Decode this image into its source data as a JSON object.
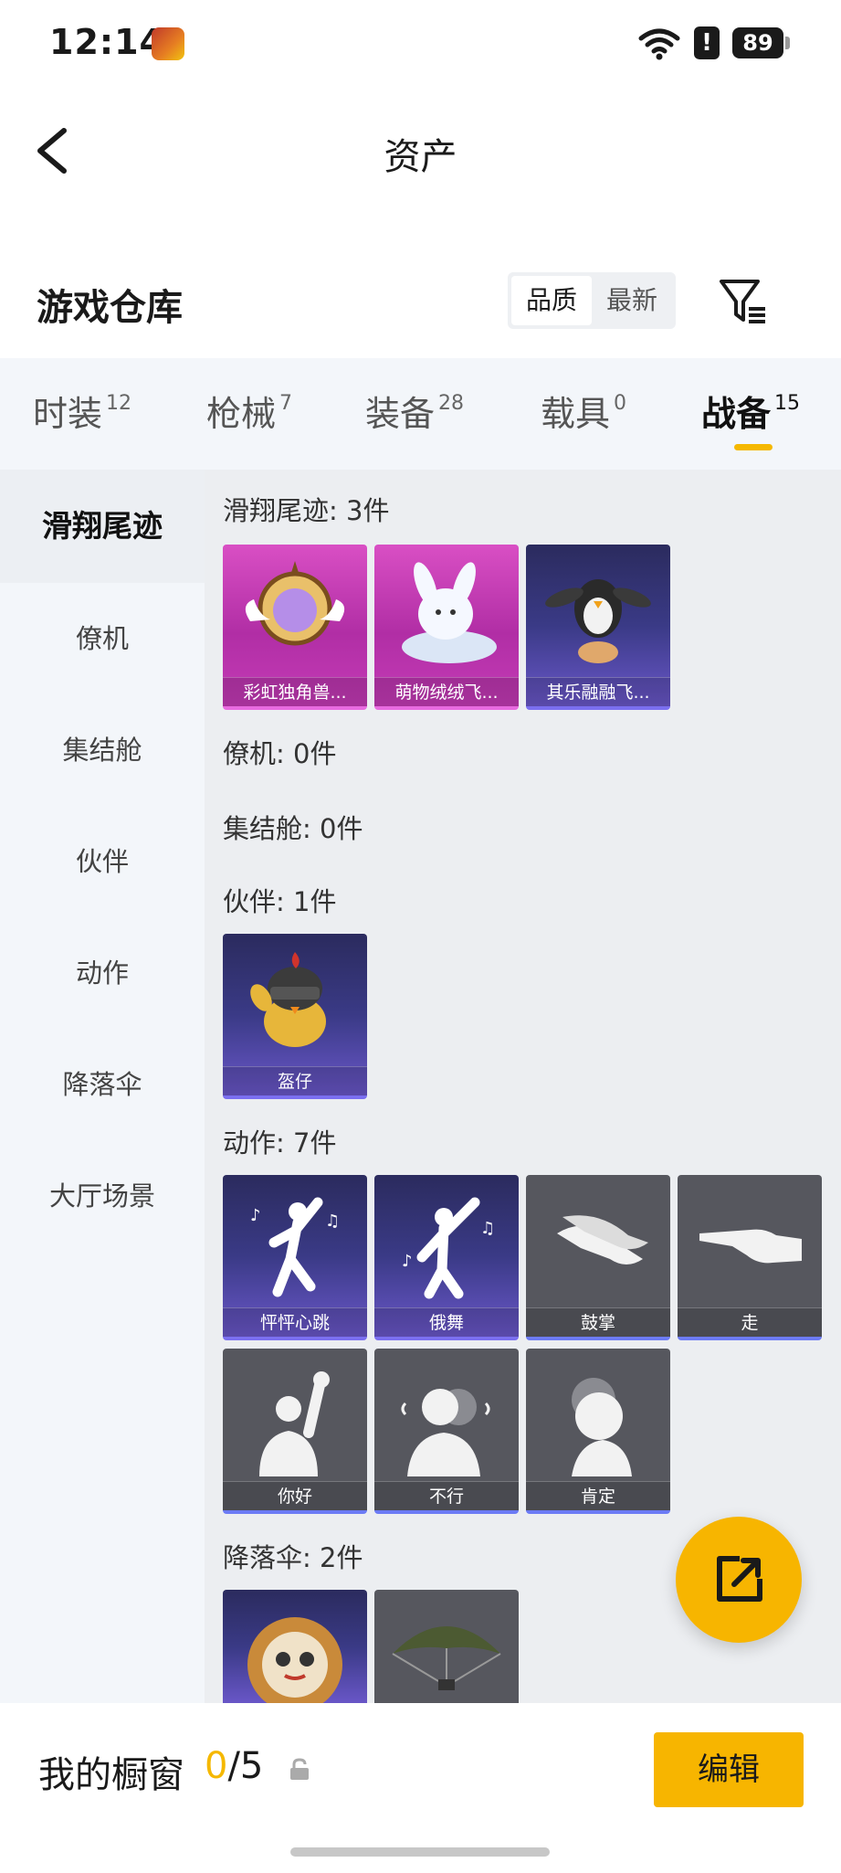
{
  "status_bar": {
    "time": "12:14",
    "alert": "!",
    "battery": "89"
  },
  "header": {
    "title": "资产"
  },
  "warehouse": {
    "title": "游戏仓库",
    "sort_options": [
      "品质",
      "最新"
    ],
    "sort_selected": "品质"
  },
  "tabs": [
    {
      "label": "时装",
      "count": "12"
    },
    {
      "label": "枪械",
      "count": "7"
    },
    {
      "label": "装备",
      "count": "28"
    },
    {
      "label": "载具",
      "count": "0"
    },
    {
      "label": "战备",
      "count": "15",
      "active": true
    }
  ],
  "sidebar": {
    "items": [
      "滑翔尾迹",
      "僚机",
      "集结舱",
      "伙伴",
      "动作",
      "降落伞",
      "大厅场景"
    ],
    "active": "滑翔尾迹"
  },
  "sections": {
    "glide": {
      "label": "滑翔尾迹: 3件",
      "items": [
        "彩虹独角兽...",
        "萌物绒绒飞...",
        "其乐融融飞..."
      ]
    },
    "wingman": {
      "label": "僚机: 0件"
    },
    "pod": {
      "label": "集结舱: 0件"
    },
    "companion": {
      "label": "伙伴: 1件",
      "items": [
        "盔仔"
      ]
    },
    "emote": {
      "label": "动作: 7件",
      "items": [
        "怦怦心跳",
        "俄舞",
        "鼓掌",
        "走",
        "你好",
        "不行",
        "肯定"
      ]
    },
    "parachute": {
      "label": "降落伞: 2件"
    }
  },
  "bottom_bar": {
    "showcase_label": "我的橱窗",
    "showcase_current": "0",
    "showcase_total": "/5",
    "edit_label": "编辑"
  },
  "colors": {
    "accent": "#f7b500",
    "purple_rarity": "#c43bb6",
    "dark_rarity": "#3a3a86",
    "gray_card": "#56575e"
  },
  "icons": [
    "back-arrow-icon",
    "filter-icon",
    "share-icon",
    "lock-icon",
    "wifi-icon",
    "battery-icon"
  ]
}
